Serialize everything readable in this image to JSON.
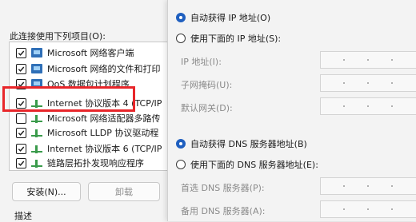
{
  "props_dialog": {
    "connection_label": "此连接使用下列项目(O):",
    "items": [
      {
        "label": "Microsoft 网络客户端",
        "checked": true,
        "icon": "network-client-icon"
      },
      {
        "label": "Microsoft 网络的文件和打印",
        "checked": true,
        "icon": "network-share-icon"
      },
      {
        "label": "QoS 数据包计划程序",
        "checked": true,
        "icon": "qos-icon"
      },
      {
        "label": "Internet 协议版本 4 (TCP/IP",
        "checked": true,
        "icon": "protocol-icon"
      },
      {
        "label": "Microsoft 网络适配器多路传",
        "checked": false,
        "icon": "protocol-icon"
      },
      {
        "label": "Microsoft LLDP 协议驱动程",
        "checked": true,
        "icon": "protocol-icon"
      },
      {
        "label": "Internet 协议版本 6 (TCP/IP",
        "checked": true,
        "icon": "protocol-icon"
      },
      {
        "label": "链路层拓扑发现响应程序",
        "checked": true,
        "icon": "protocol-icon"
      }
    ],
    "install_button": "安装(N)...",
    "uninstall_button": "卸载",
    "description_label": "描述"
  },
  "ipv4_dialog": {
    "auto_ip": "自动获得 IP 地址(O)",
    "manual_ip": "使用下面的 IP 地址(S):",
    "ip_address_label": "IP 地址(I):",
    "subnet_label": "子网掩码(U):",
    "gateway_label": "默认网关(D):",
    "auto_dns": "自动获得 DNS 服务器地址(B)",
    "manual_dns": "使用下面的 DNS 服务器地址(E):",
    "preferred_dns_label": "首选 DNS 服务器(P):",
    "alternate_dns_label": "备用 DNS 服务器(A):",
    "selected_ip_option": "auto",
    "selected_dns_option": "auto"
  },
  "colors": {
    "highlight": "#e8262a",
    "radio_accent": "#1f5fbf"
  }
}
